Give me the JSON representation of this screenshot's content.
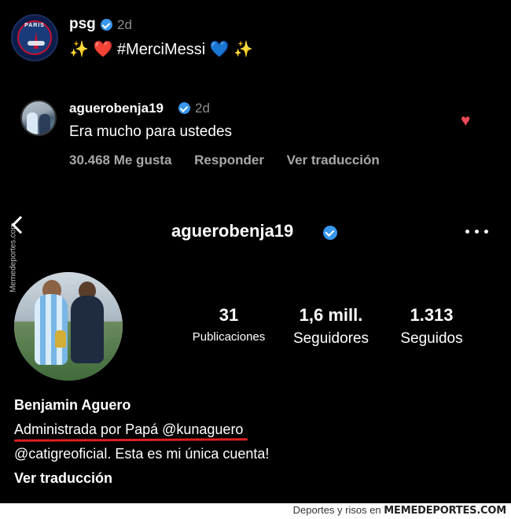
{
  "post": {
    "author": "psg",
    "time": "2d",
    "caption_emoji_left": "✨",
    "caption_heart_left": "❤️",
    "caption_text": "#MerciMessi",
    "caption_heart_right": "💙",
    "caption_emoji_right": "✨"
  },
  "comment": {
    "author": "aguerobenja19",
    "time": "2d",
    "text": "Era mucho para ustedes",
    "likes": "30.468 Me gusta",
    "reply_label": "Responder",
    "translate_label": "Ver traducción",
    "heart_icon": "♥"
  },
  "profile": {
    "username": "aguerobenja19",
    "stats": {
      "posts_count": "31",
      "posts_label": "Publicaciones",
      "followers_count": "1,6 mill.",
      "followers_label": "Seguidores",
      "following_count": "1.313",
      "following_label": "Seguidos"
    },
    "bio": {
      "name": "Benjamin Aguero",
      "line1": "Administrada por Papá @kunaguero",
      "line2": "@catigreoficial. Esta es mi única cuenta!",
      "translate": "Ver traducción"
    }
  },
  "watermark": {
    "side": "Memedeportes.com",
    "footer_prefix": "Deportes y risos en",
    "footer_brand": "MEMEDEPORTES.COM"
  },
  "colors": {
    "background": "#000000",
    "verified": "#3897f0",
    "like_heart": "#ed4956",
    "underline": "#e0201e",
    "muted_text": "#a8a8a8"
  }
}
